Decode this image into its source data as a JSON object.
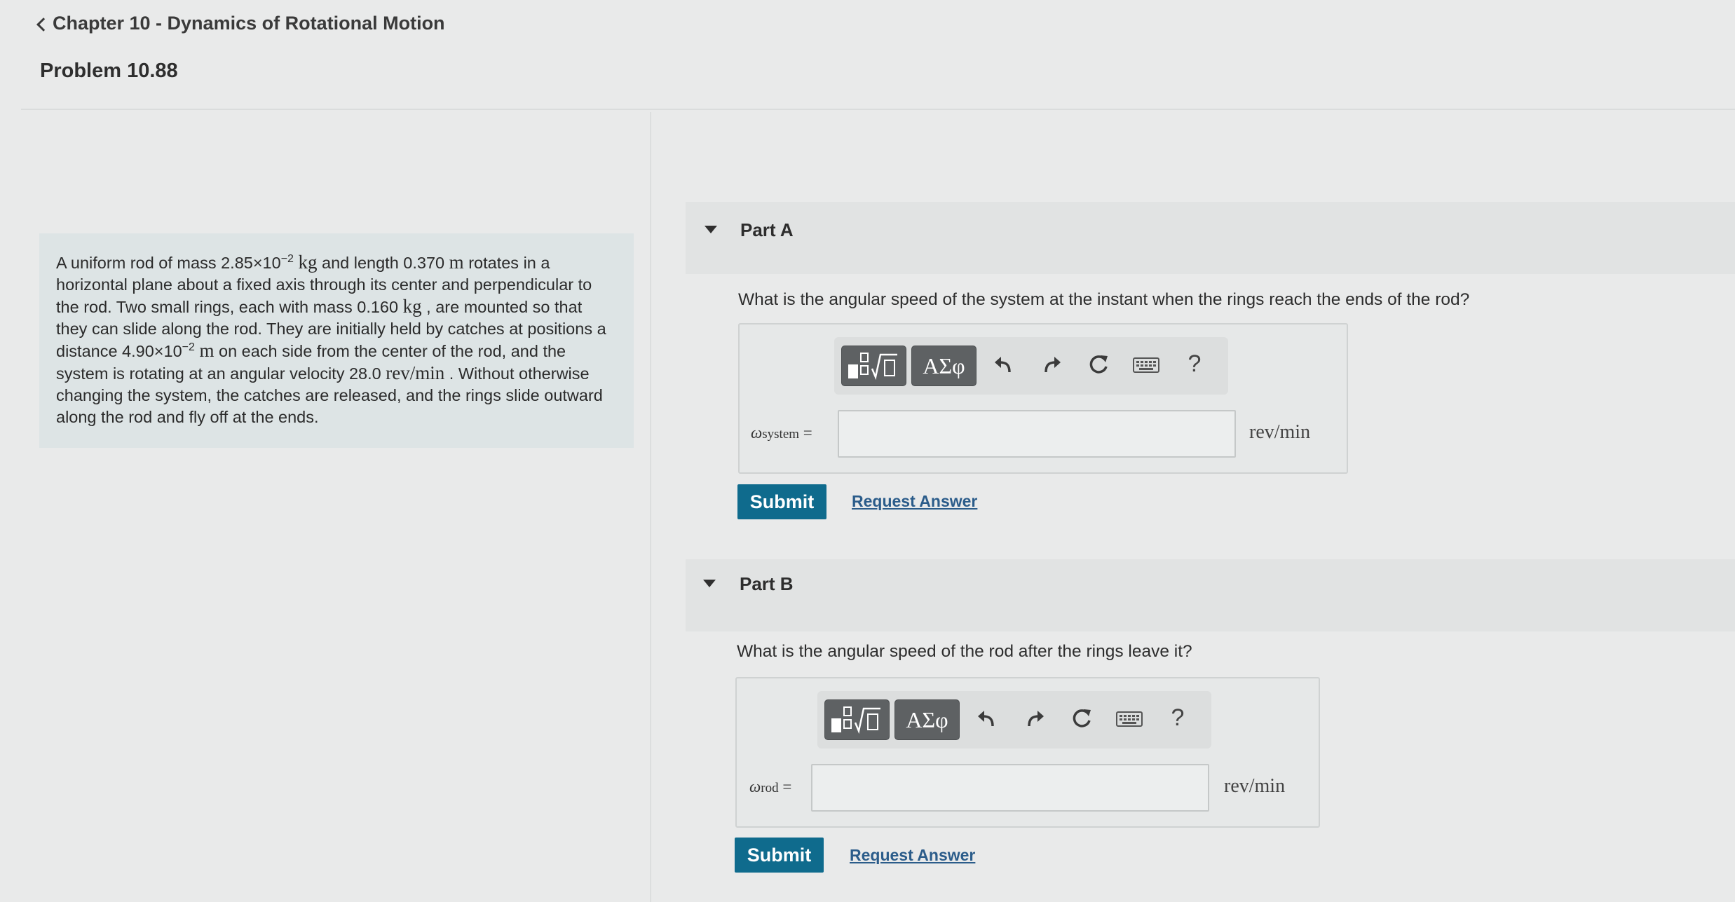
{
  "header": {
    "back_label": "Chapter 10 - Dynamics of Rotational Motion",
    "problem_title": "Problem 10.88"
  },
  "problem": {
    "t1": "A uniform rod of mass 2.85×10",
    "e1": "−2",
    "u1": "kg",
    "t2": " and length 0.370 ",
    "u2": "m",
    "t3": " rotates in a horizontal plane about a fixed axis through its center and perpendicular to the rod. Two small rings, each with mass 0.160 ",
    "u3": "kg",
    "t4": " , are mounted so that they can slide along the rod. They are initially held by catches at positions a distance 4.90×10",
    "e2": "−2",
    "u4": "m",
    "t5": " on each side from the center of the rod, and the system is rotating at an angular velocity 28.0 ",
    "u5": "rev/min",
    "t6": " . Without otherwise changing the system, the catches are released, and the rings slide outward along the rod and fly off at the ends."
  },
  "toolbar": {
    "templates_icon": "templates-icon",
    "symbols_label": "ΑΣφ",
    "undo_icon": "undo-icon",
    "redo_icon": "redo-icon",
    "reset_icon": "reset-icon",
    "keyboard_icon": "keyboard-icon",
    "help_label": "?"
  },
  "parts": [
    {
      "title": "Part A",
      "question": "What is the angular speed of the system at the instant when the rings reach the ends of the rod?",
      "variable": "ω",
      "variable_sub": "system",
      "equals": " =",
      "input_value": "",
      "unit": "rev/min",
      "submit_label": "Submit",
      "request_label": "Request Answer"
    },
    {
      "title": "Part B",
      "question": "What is the angular speed of the rod after the rings leave it?",
      "variable": "ω",
      "variable_sub": "rod",
      "equals": " =",
      "input_value": "",
      "unit": "rev/min",
      "submit_label": "Submit",
      "request_label": "Request Answer"
    }
  ],
  "colors": {
    "background": "#e9eaea",
    "problem_box": "#dde4e5",
    "submit_button": "#0f6b8d",
    "link": "#2b5c8a",
    "toolbar_button": "#5e6163"
  }
}
